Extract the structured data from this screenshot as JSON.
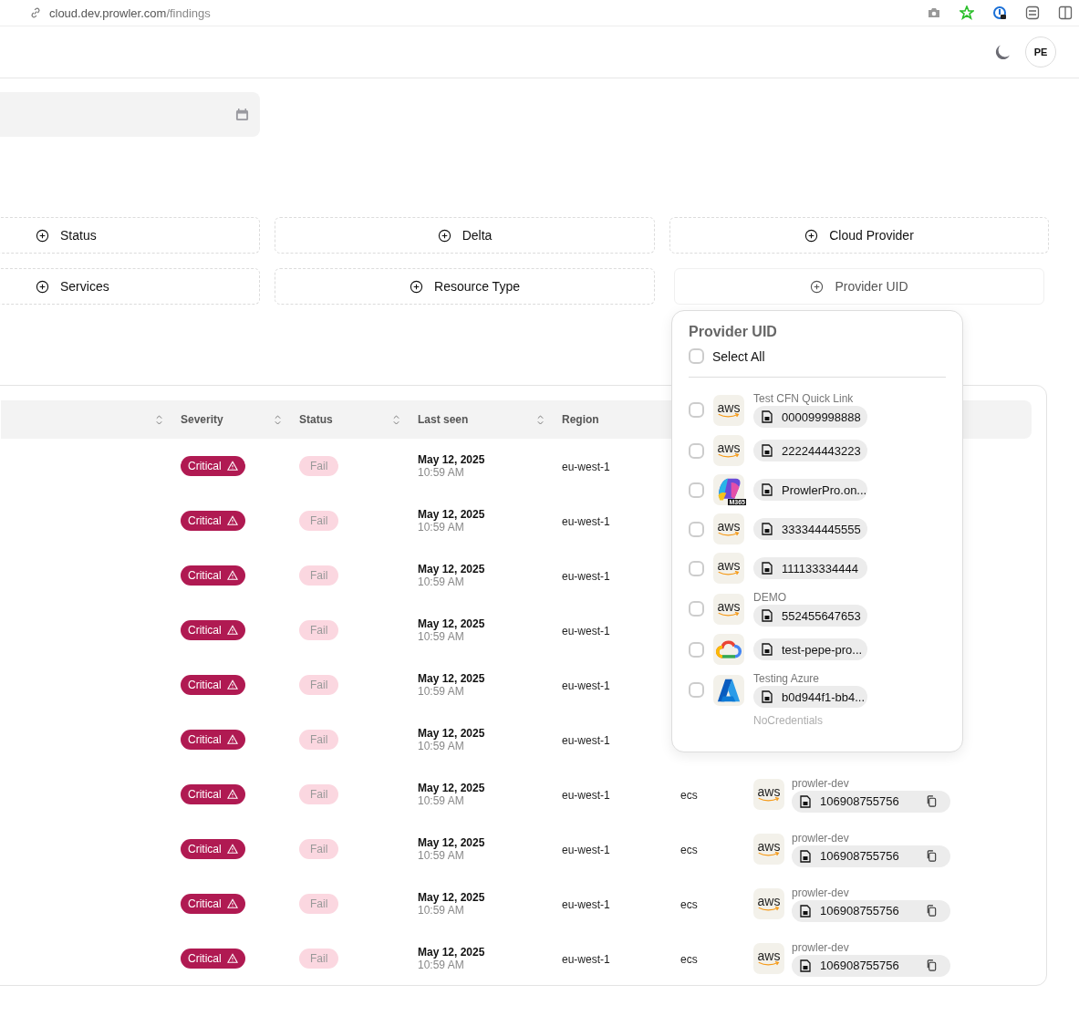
{
  "browser": {
    "url_host": "cloud.dev.prowler.com",
    "url_path": "/findings"
  },
  "header": {
    "avatar": "PE"
  },
  "filters": [
    {
      "label": "Status",
      "muted": false
    },
    {
      "label": "Delta",
      "muted": false
    },
    {
      "label": "Cloud Provider",
      "muted": false
    },
    {
      "label": "Services",
      "muted": false
    },
    {
      "label": "Resource Type",
      "muted": false
    },
    {
      "label": "Provider UID",
      "muted": true
    }
  ],
  "table": {
    "columns": [
      "",
      "Severity",
      "Status",
      "Last seen",
      "Region"
    ],
    "rows": [
      {
        "severity": "Critical",
        "status": "Fail",
        "date": "May 12, 2025",
        "time": "10:59 AM",
        "region": "eu-west-1"
      },
      {
        "severity": "Critical",
        "status": "Fail",
        "date": "May 12, 2025",
        "time": "10:59 AM",
        "region": "eu-west-1"
      },
      {
        "severity": "Critical",
        "status": "Fail",
        "date": "May 12, 2025",
        "time": "10:59 AM",
        "region": "eu-west-1"
      },
      {
        "severity": "Critical",
        "status": "Fail",
        "date": "May 12, 2025",
        "time": "10:59 AM",
        "region": "eu-west-1"
      },
      {
        "severity": "Critical",
        "status": "Fail",
        "date": "May 12, 2025",
        "time": "10:59 AM",
        "region": "eu-west-1"
      },
      {
        "severity": "Critical",
        "status": "Fail",
        "date": "May 12, 2025",
        "time": "10:59 AM",
        "region": "eu-west-1"
      },
      {
        "severity": "Critical",
        "status": "Fail",
        "date": "May 12, 2025",
        "time": "10:59 AM",
        "region": "eu-west-1",
        "service": "ecs",
        "provider": {
          "logo": "aws",
          "alias": "prowler-dev",
          "uid": "106908755756"
        }
      },
      {
        "severity": "Critical",
        "status": "Fail",
        "date": "May 12, 2025",
        "time": "10:59 AM",
        "region": "eu-west-1",
        "service": "ecs",
        "provider": {
          "logo": "aws",
          "alias": "prowler-dev",
          "uid": "106908755756"
        }
      },
      {
        "severity": "Critical",
        "status": "Fail",
        "date": "May 12, 2025",
        "time": "10:59 AM",
        "region": "eu-west-1",
        "service": "ecs",
        "provider": {
          "logo": "aws",
          "alias": "prowler-dev",
          "uid": "106908755756"
        }
      },
      {
        "severity": "Critical",
        "status": "Fail",
        "date": "May 12, 2025",
        "time": "10:59 AM",
        "region": "eu-west-1",
        "service": "ecs",
        "provider": {
          "logo": "aws",
          "alias": "prowler-dev",
          "uid": "106908755756"
        }
      }
    ]
  },
  "dropdown": {
    "title": "Provider UID",
    "select_all": {
      "label": "Select All",
      "checked": false
    },
    "items": [
      {
        "kind": "aws",
        "logo_text": "aws",
        "alias": "Test CFN Quick Link",
        "uid": "000099998888",
        "checked": false
      },
      {
        "kind": "aws",
        "logo_text": "aws",
        "uid": "222244443223",
        "checked": false
      },
      {
        "kind": "m365",
        "logo_text": "M365",
        "uid": "ProwlerPro.on...",
        "checked": false
      },
      {
        "kind": "aws",
        "logo_text": "aws",
        "uid": "333344445555",
        "checked": false
      },
      {
        "kind": "aws",
        "logo_text": "aws",
        "uid": "111133334444",
        "checked": false
      },
      {
        "kind": "aws",
        "logo_text": "aws",
        "alias": "DEMO",
        "uid": "552455647653",
        "checked": false
      },
      {
        "kind": "gcp",
        "uid": "test-pepe-pro...",
        "checked": false
      },
      {
        "kind": "azure",
        "alias": "Testing Azure",
        "uid": "b0d944f1-bb4...",
        "checked": false
      }
    ],
    "partial_item": {
      "alias": "NoCredentials"
    }
  }
}
